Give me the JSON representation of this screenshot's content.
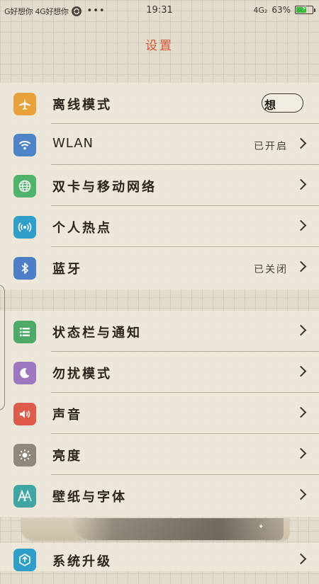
{
  "status_bar": {
    "carrier_text": "G好想你 4G好想你",
    "more": "•••",
    "time": "19:31",
    "network": "4G₂",
    "battery_percent_text": "63%",
    "battery_level": 0.63,
    "battery_color": "#3bb83b"
  },
  "header": {
    "title": "设置"
  },
  "section1": [
    {
      "label": "离线模式",
      "icon": "airplane-icon",
      "color": "#e9a23a",
      "control": "toggle",
      "toggle_text": "想"
    },
    {
      "label": "WLAN",
      "icon": "wifi-icon",
      "color": "#4f83c8",
      "value": "已开启"
    },
    {
      "label": "双卡与移动网络",
      "icon": "globe-icon",
      "color": "#4fb36c"
    },
    {
      "label": "个人热点",
      "icon": "hotspot-icon",
      "color": "#2f9fc9"
    },
    {
      "label": "蓝牙",
      "icon": "bluetooth-icon",
      "color": "#4f7ec8",
      "value": "已关闭"
    }
  ],
  "section2": [
    {
      "label": "状态栏与通知",
      "icon": "status-bar-icon",
      "color": "#4fa969"
    },
    {
      "label": "勿扰模式",
      "icon": "moon-icon",
      "color": "#9d78c1"
    },
    {
      "label": "声音",
      "icon": "speaker-icon",
      "color": "#de5a4a"
    },
    {
      "label": "亮度",
      "icon": "sun-icon",
      "color": "#8d877c"
    },
    {
      "label": "壁纸与字体",
      "icon": "wallpaper-font-icon",
      "color": "#3fa6a3"
    }
  ],
  "section3": [
    {
      "label": "系统升级",
      "icon": "system-update-icon",
      "color": "#2f9fc9"
    }
  ]
}
